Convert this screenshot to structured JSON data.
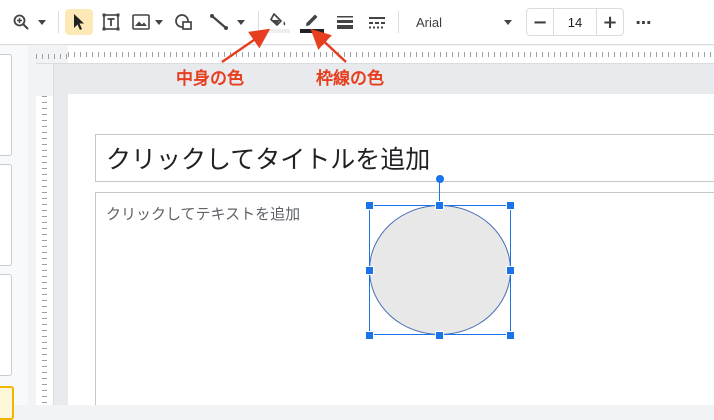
{
  "toolbar": {
    "font_name": "Arial",
    "font_size": "14",
    "minus_label": "−",
    "plus_label": "+",
    "more_label": "⋯",
    "icons": [
      "zoom-icon",
      "select-pointer-icon",
      "text-box-icon",
      "image-icon",
      "shape-icon",
      "line-icon",
      "fill-color-icon",
      "border-color-icon",
      "border-weight-icon",
      "border-dash-icon"
    ],
    "fill_color": "#eeeeee",
    "border_color": "#202124"
  },
  "slide": {
    "title_placeholder": "クリックしてタイトルを追加",
    "body_placeholder": "クリックしてテキストを追加"
  },
  "shape": {
    "type": "ellipse",
    "fill": "#e8e8e8",
    "stroke": "#4a6fb5",
    "selected": true
  },
  "annotations": {
    "fill_label": "中身の色",
    "border_label": "枠線の色",
    "color": "#e53f1f"
  }
}
